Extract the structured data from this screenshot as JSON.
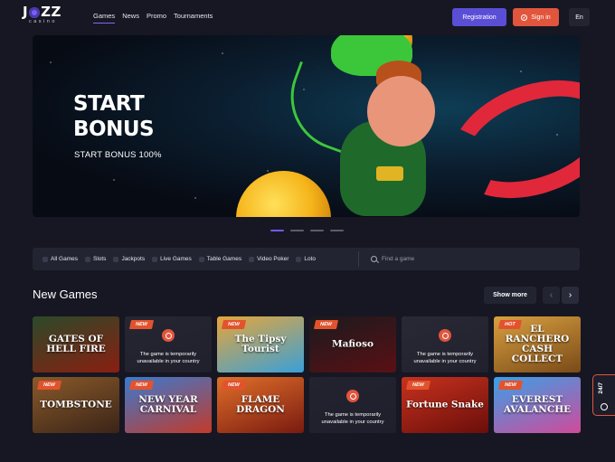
{
  "header": {
    "logo_main": "JOZZ",
    "logo_sub": "casino",
    "nav": [
      "Games",
      "News",
      "Promo",
      "Tournaments"
    ],
    "registration": "Registration",
    "signin": "Sign in",
    "lang": "En"
  },
  "banner": {
    "title_line1": "START",
    "title_line2": "BONUS",
    "subtitle": "START BONUS 100%",
    "slides_count": 4,
    "active_slide": 1
  },
  "filters": {
    "categories": [
      "All Games",
      "Slots",
      "Jackpots",
      "Live Games",
      "Table Games",
      "Video Poker",
      "Loto"
    ],
    "search_placeholder": "Find a game"
  },
  "section": {
    "title": "New Games",
    "show_more": "Show more"
  },
  "games": [
    {
      "name": "GATES OF HELL FIRE",
      "badge": "",
      "unavailable": false,
      "c1": "#2c4a2a",
      "c2": "#8a1e10"
    },
    {
      "name": "",
      "badge": "NEW",
      "unavailable": true,
      "c1": "#4a4a52",
      "c2": "#2a2a32"
    },
    {
      "name": "The Tipsy Tourist",
      "badge": "NEW",
      "unavailable": false,
      "c1": "#e6a53a",
      "c2": "#3aa0d8"
    },
    {
      "name": "Mafioso",
      "badge": "NEW",
      "unavailable": false,
      "c1": "#1a1a1e",
      "c2": "#5a1014"
    },
    {
      "name": "",
      "badge": "",
      "unavailable": true,
      "c1": "#5a5a62",
      "c2": "#2e2e36"
    },
    {
      "name": "EL RANCHERO CASH COLLECT",
      "badge": "HOT",
      "unavailable": false,
      "c1": "#d8a040",
      "c2": "#7a4a18"
    },
    {
      "name": "TOMBSTONE",
      "badge": "NEW",
      "unavailable": false,
      "c1": "#8a5a2a",
      "c2": "#3a2418"
    },
    {
      "name": "NEW YEAR CARNIVAL",
      "badge": "NEW",
      "unavailable": false,
      "c1": "#3a7ad0",
      "c2": "#c23a2a"
    },
    {
      "name": "FLAME DRAGON",
      "badge": "NEW",
      "unavailable": false,
      "c1": "#e0702a",
      "c2": "#7a1a10"
    },
    {
      "name": "",
      "badge": "",
      "unavailable": true,
      "c1": "#3a3a44",
      "c2": "#222230"
    },
    {
      "name": "Fortune Snake",
      "badge": "NEW",
      "unavailable": false,
      "c1": "#c8321e",
      "c2": "#6a0e0a"
    },
    {
      "name": "EVEREST AVALANCHE",
      "badge": "NEW",
      "unavailable": false,
      "c1": "#3aa0e8",
      "c2": "#d04a9a"
    }
  ],
  "unavailable_text": "The game is temporarily unavailable in your country",
  "chat": {
    "label": "24/7"
  }
}
